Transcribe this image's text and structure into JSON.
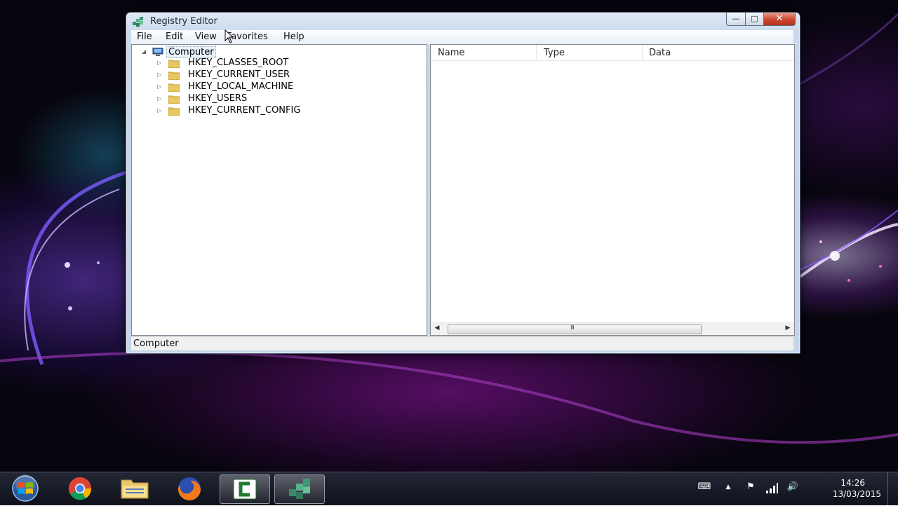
{
  "window": {
    "title": "Registry Editor",
    "caption": {
      "minimize": "—",
      "maximize": "□",
      "close": "✕"
    }
  },
  "menu": {
    "items": [
      "File",
      "Edit",
      "View",
      "Favorites",
      "Help"
    ]
  },
  "tree": {
    "root": {
      "label": "Computer",
      "expander": "◢"
    },
    "keys": [
      {
        "label": "HKEY_CLASSES_ROOT",
        "expander": "▷"
      },
      {
        "label": "HKEY_CURRENT_USER",
        "expander": "▷"
      },
      {
        "label": "HKEY_LOCAL_MACHINE",
        "expander": "▷"
      },
      {
        "label": "HKEY_USERS",
        "expander": "▷"
      },
      {
        "label": "HKEY_CURRENT_CONFIG",
        "expander": "▷"
      }
    ]
  },
  "list": {
    "columns": [
      "Name",
      "Type",
      "Data"
    ],
    "scroll": {
      "left": "◀",
      "right": "▶",
      "grip": "III"
    }
  },
  "statusbar": {
    "text": "Computer"
  },
  "taskbar": {
    "apps": [
      {
        "name": "chrome-icon",
        "active": false
      },
      {
        "name": "folder-icon",
        "active": false
      },
      {
        "name": "firefox-icon",
        "active": false
      },
      {
        "name": "camtasia-icon",
        "active": true
      },
      {
        "name": "registry-editor-icon",
        "active": true
      }
    ],
    "tray": {
      "keyboard": "⌨",
      "show_hidden": "▲",
      "flag": "⚑",
      "volume": "🔊"
    },
    "clock": {
      "time": "14:26",
      "date": "13/03/2015"
    }
  },
  "colors": {
    "window_frame": "#c9d8ea",
    "close_button": "#c9462d",
    "folder_yellow": "#e8c760",
    "desktop_bg": "#07050d",
    "accent_purple": "#9a3bd0"
  }
}
